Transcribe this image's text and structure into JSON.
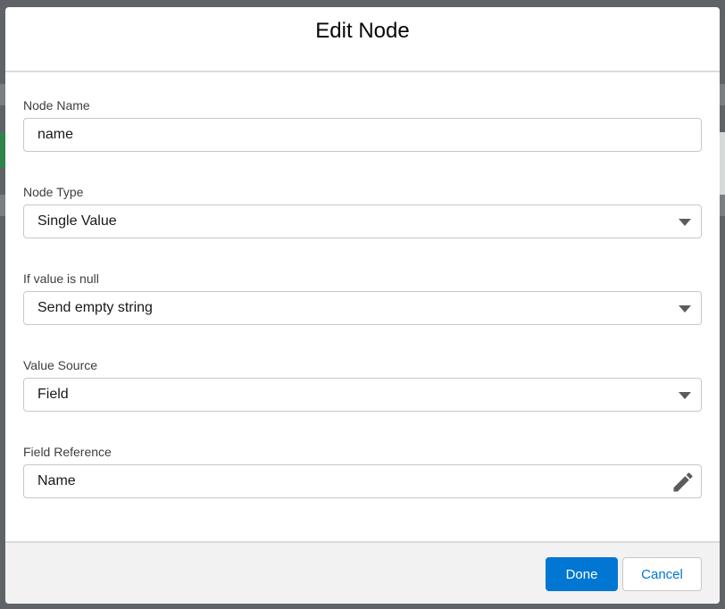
{
  "modal": {
    "title": "Edit Node"
  },
  "form": {
    "node_name": {
      "label": "Node Name",
      "value": "name"
    },
    "node_type": {
      "label": "Node Type",
      "value": "Single Value"
    },
    "if_null": {
      "label": "If value is null",
      "value": "Send empty string"
    },
    "value_source": {
      "label": "Value Source",
      "value": "Field"
    },
    "field_reference": {
      "label": "Field Reference",
      "value": "Name"
    }
  },
  "footer": {
    "done_label": "Done",
    "cancel_label": "Cancel"
  },
  "icons": {
    "dropdown": "chevron-down-icon",
    "edit": "pencil-icon"
  },
  "colors": {
    "brand": "#0176d3",
    "backdrop": "#5f6266",
    "footer_bg": "#f3f2f2",
    "border": "#c9c7c5"
  }
}
